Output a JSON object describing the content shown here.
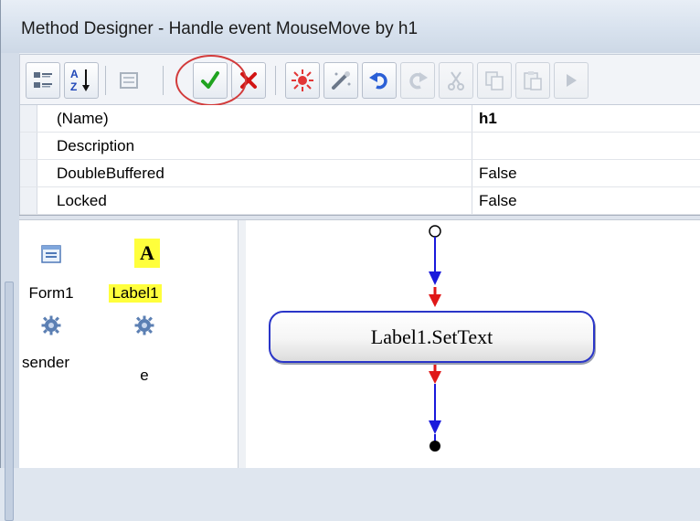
{
  "window": {
    "title": "Method Designer - Handle event MouseMove by h1"
  },
  "toolbar": {
    "buttons": [
      {
        "name": "categorized-icon",
        "enabled": true
      },
      {
        "name": "alphabetical-sort-icon",
        "enabled": true
      },
      {
        "name": "property-pages-icon",
        "enabled": false
      },
      {
        "name": "ok-checkmark-icon",
        "enabled": true
      },
      {
        "name": "cancel-x-icon",
        "enabled": true
      },
      {
        "name": "debug-icon",
        "enabled": true
      },
      {
        "name": "wand-icon",
        "enabled": true
      },
      {
        "name": "undo-icon",
        "enabled": true
      },
      {
        "name": "redo-icon",
        "enabled": false
      },
      {
        "name": "cut-icon",
        "enabled": false
      },
      {
        "name": "copy-icon",
        "enabled": false
      },
      {
        "name": "paste-icon",
        "enabled": false
      },
      {
        "name": "run-icon",
        "enabled": false
      }
    ],
    "colors": {
      "ok": "#1fa31f",
      "cancel": "#d21414",
      "highlight_ring": "#d23b3b"
    }
  },
  "properties": [
    {
      "name": "(Name)",
      "value": "h1",
      "bold": true
    },
    {
      "name": "Description",
      "value": ""
    },
    {
      "name": "DoubleBuffered",
      "value": "False"
    },
    {
      "name": "Locked",
      "value": "False"
    }
  ],
  "objects": [
    {
      "label": "Form1",
      "icon": "form-icon",
      "highlighted": false
    },
    {
      "label": "Label1",
      "icon": "label-a-icon",
      "highlighted": true,
      "icon_text": "A"
    },
    {
      "label": "sender",
      "icon": "gear-icon",
      "highlighted": false
    },
    {
      "label": "e",
      "icon": "gear-icon",
      "highlighted": false
    }
  ],
  "diagram": {
    "action_label": "Label1.SetText",
    "colors": {
      "flow_line": "#1a1adb",
      "inlet": "#e01818",
      "border": "#2a35c8"
    }
  }
}
